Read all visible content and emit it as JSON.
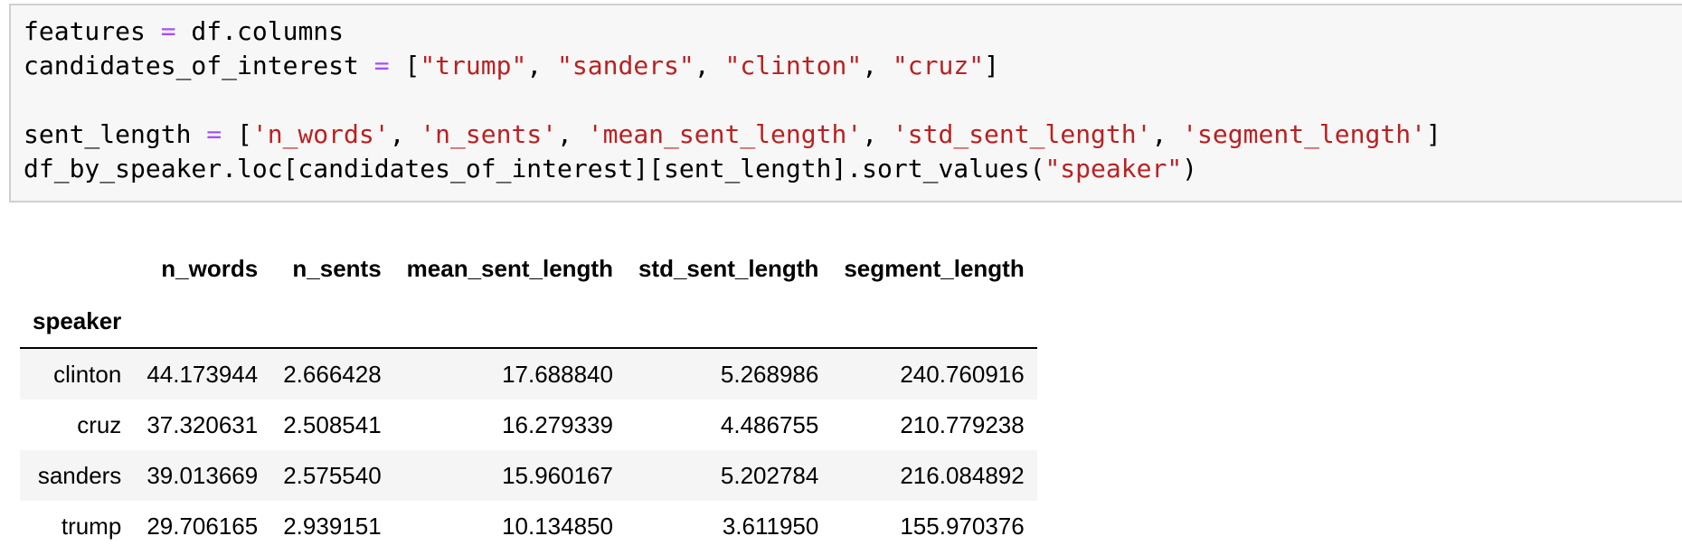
{
  "code_cell": {
    "lines": [
      [
        {
          "t": "txt",
          "v": "features "
        },
        {
          "t": "op",
          "v": "="
        },
        {
          "t": "txt",
          "v": " df.columns"
        }
      ],
      [
        {
          "t": "txt",
          "v": "candidates_of_interest "
        },
        {
          "t": "op",
          "v": "="
        },
        {
          "t": "txt",
          "v": " ["
        },
        {
          "t": "str",
          "v": "\"trump\""
        },
        {
          "t": "txt",
          "v": ", "
        },
        {
          "t": "str",
          "v": "\"sanders\""
        },
        {
          "t": "txt",
          "v": ", "
        },
        {
          "t": "str",
          "v": "\"clinton\""
        },
        {
          "t": "txt",
          "v": ", "
        },
        {
          "t": "str",
          "v": "\"cruz\""
        },
        {
          "t": "txt",
          "v": "]"
        }
      ],
      [],
      [
        {
          "t": "txt",
          "v": "sent_length "
        },
        {
          "t": "op",
          "v": "="
        },
        {
          "t": "txt",
          "v": " ["
        },
        {
          "t": "str",
          "v": "'n_words'"
        },
        {
          "t": "txt",
          "v": ", "
        },
        {
          "t": "str",
          "v": "'n_sents'"
        },
        {
          "t": "txt",
          "v": ", "
        },
        {
          "t": "str",
          "v": "'mean_sent_length'"
        },
        {
          "t": "txt",
          "v": ", "
        },
        {
          "t": "str",
          "v": "'std_sent_length'"
        },
        {
          "t": "txt",
          "v": ", "
        },
        {
          "t": "str",
          "v": "'segment_length'"
        },
        {
          "t": "txt",
          "v": "]"
        }
      ],
      [
        {
          "t": "txt",
          "v": "df_by_speaker.loc[candidates_of_interest][sent_length].sort_values("
        },
        {
          "t": "str",
          "v": "\"speaker\""
        },
        {
          "t": "txt",
          "v": ")"
        }
      ]
    ]
  },
  "output_table": {
    "columns": [
      "n_words",
      "n_sents",
      "mean_sent_length",
      "std_sent_length",
      "segment_length"
    ],
    "index_name": "speaker",
    "rows": [
      {
        "index": "clinton",
        "values": [
          "44.173944",
          "2.666428",
          "17.688840",
          "5.268986",
          "240.760916"
        ]
      },
      {
        "index": "cruz",
        "values": [
          "37.320631",
          "2.508541",
          "16.279339",
          "4.486755",
          "210.779238"
        ]
      },
      {
        "index": "sanders",
        "values": [
          "39.013669",
          "2.575540",
          "15.960167",
          "5.202784",
          "216.084892"
        ]
      },
      {
        "index": "trump",
        "values": [
          "29.706165",
          "2.939151",
          "10.134850",
          "3.611950",
          "155.970376"
        ]
      }
    ]
  },
  "colors": {
    "operator": "#a64dff",
    "string": "#ba2121",
    "cell_background": "#f7f7f7",
    "row_stripe": "#f5f5f5"
  }
}
